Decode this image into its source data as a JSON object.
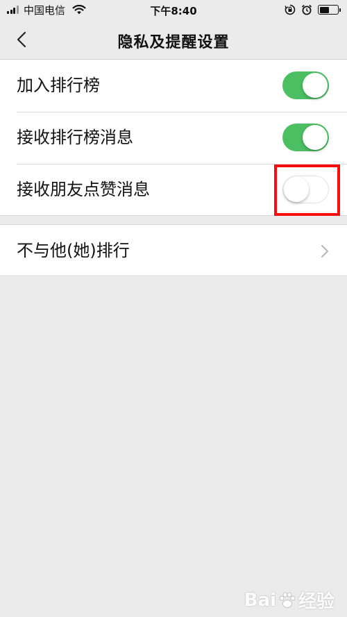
{
  "status_bar": {
    "carrier": "中国电信",
    "time": "下午8:40",
    "icons": [
      "signal-icon",
      "wifi-icon",
      "orientation-lock-icon",
      "alarm-icon",
      "battery-icon"
    ]
  },
  "nav": {
    "title": "隐私及提醒设置",
    "back_icon": "chevron-left-icon"
  },
  "settings": {
    "rows": [
      {
        "label": "加入排行榜",
        "toggle": "on"
      },
      {
        "label": "接收排行榜消息",
        "toggle": "on"
      },
      {
        "label": "接收朋友点赞消息",
        "toggle": "off",
        "highlighted": true
      }
    ],
    "link_row": {
      "label": "不与他(她)排行",
      "icon": "chevron-right-icon"
    }
  },
  "colors": {
    "toggle_on": "#4cbf62",
    "highlight": "#ff0a0a",
    "background": "#ebebeb"
  },
  "watermark": {
    "text_before": "Bai",
    "text_after": "经验",
    "sub": "du"
  }
}
